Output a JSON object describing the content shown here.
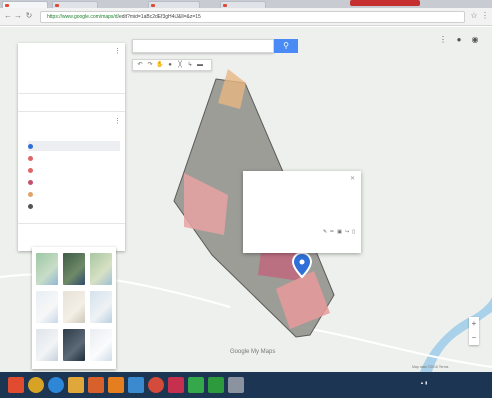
{
  "browser": {
    "tabs": [
      "",
      "",
      "",
      ""
    ],
    "url_secure": "https://www.google.com/maps/d/",
    "url_rest": "edit?mid=1aBc2dEf3gH4iJ&ll=&z=15"
  },
  "map": {
    "search_placeholder": "",
    "search_button_icon": "search-icon",
    "layer_name": "",
    "fill_colors": {
      "hexagon": "#8e8e88",
      "pink_a": "#e8a2a2",
      "pink_b": "#e79a9a",
      "dark": "#bf6b7f",
      "orange": "#e8b682",
      "river": "#a9d2ea",
      "road": "#ffffff"
    }
  },
  "panel": {
    "title": "",
    "subtitle": "",
    "note": "",
    "actions": [
      "",
      "",
      ""
    ],
    "layer_title": "",
    "layer_style": "",
    "items": [
      {
        "label": "",
        "color": "#2f6fd8"
      },
      {
        "label": "",
        "color": "#e06666"
      },
      {
        "label": "",
        "color": "#e06666"
      },
      {
        "label": "",
        "color": "#c2506e"
      },
      {
        "label": "",
        "color": "#e0a46a"
      },
      {
        "label": "",
        "color": "#555555"
      }
    ],
    "basemap_label": ""
  },
  "infowindow": {
    "title": "",
    "description": "",
    "footer": ""
  },
  "branding": {
    "label": "Google My Maps"
  },
  "system": {
    "time": "",
    "date": ""
  }
}
